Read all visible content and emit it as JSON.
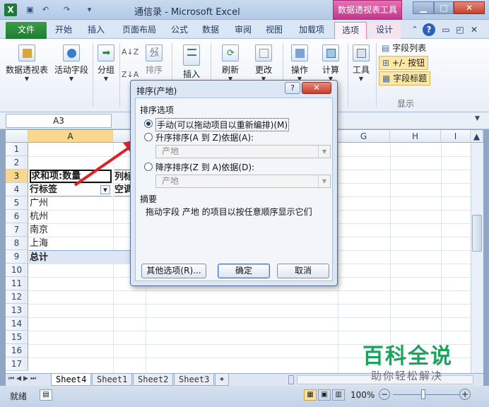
{
  "titlebar": {
    "app_icon": "X",
    "title": "通信录 - Microsoft Excel",
    "context_tab_title": "数据透视表工具",
    "controls": [
      "minimize-icon",
      "maximize-icon",
      "close-icon"
    ]
  },
  "tabs": {
    "file": "文件",
    "items": [
      "开始",
      "插入",
      "页面布局",
      "公式",
      "数据",
      "审阅",
      "视图",
      "加载项",
      "选项",
      "设计"
    ]
  },
  "ribbon": {
    "pivot_table": "数据透视表",
    "active_field": "活动字段",
    "group": "分组",
    "sort": "排序",
    "insert": "插入",
    "refresh": "刷新",
    "change": "更改",
    "actions": "操作",
    "calc": "计算",
    "tools": "工具",
    "field_list": "字段列表",
    "plus_minus": "+/- 按钮",
    "field_headers": "字段标题",
    "show_group": "显示"
  },
  "namebox": "A3",
  "columns": [
    "A",
    "G",
    "H",
    "I"
  ],
  "rows": [
    "1",
    "2",
    "3",
    "4",
    "5",
    "6",
    "7",
    "8",
    "9",
    "10",
    "11",
    "12",
    "13",
    "14",
    "15",
    "16",
    "17"
  ],
  "cells": {
    "a3": "求和项:数量",
    "b3": "列标",
    "a4": "行标签",
    "b4": "空调",
    "a5": "广州",
    "a6": "杭州",
    "a7": "南京",
    "a8": "上海",
    "a9": "总计"
  },
  "sheets": [
    "Sheet4",
    "Sheet1",
    "Sheet2",
    "Sheet3"
  ],
  "status": {
    "ready": "就绪",
    "zoom": "100%",
    "minus": "−",
    "plus": "+"
  },
  "dialog": {
    "title": "排序(产地)",
    "help": "?",
    "close": "✕",
    "section": "排序选项",
    "opt_manual": "手动(可以拖动项目以重新编排)(M)",
    "opt_asc": "升序排序(A 到 Z)依据(A):",
    "asc_value": "产地",
    "opt_desc": "降序排序(Z 到 A)依据(D):",
    "desc_value": "产地",
    "summary_label": "摘要",
    "summary_text": "拖动字段 产地 的项目以按任意顺序显示它们",
    "more_options": "其他选项(R)...",
    "ok": "确定",
    "cancel": "取消"
  },
  "watermark": {
    "title": "百科全说",
    "subtitle": "助你轻松解决"
  },
  "colors": {
    "file_tab": "#1f7b32",
    "context_tab": "#c3378a",
    "selection": "#f8d88e",
    "arrow": "#e02020"
  }
}
